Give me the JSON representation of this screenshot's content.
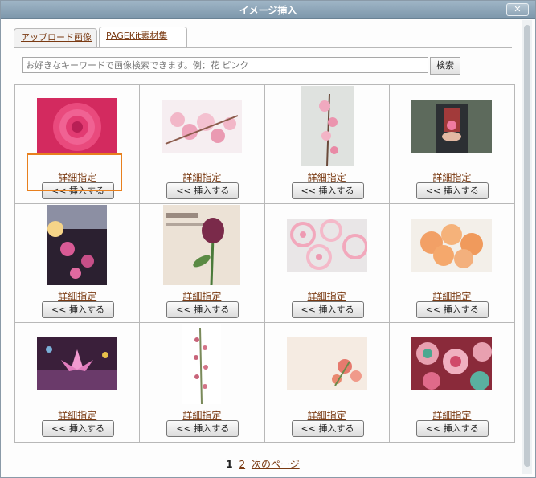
{
  "window": {
    "title": "イメージ挿入",
    "close_label": "✕"
  },
  "tabs": [
    {
      "label": "アップロード画像",
      "active": false
    },
    {
      "label": "PAGEKit素材集",
      "active": true
    }
  ],
  "search": {
    "placeholder": "お好きなキーワードで画像検索できます。例：花 ピンク",
    "button_label": "検索"
  },
  "grid": {
    "detail_label": "詳細指定",
    "insert_label": "<< 挿入する",
    "items": [
      {
        "image": "pink-rose"
      },
      {
        "image": "cherry-blossoms"
      },
      {
        "image": "cherry-blossom-branch"
      },
      {
        "image": "person-holding-flower"
      },
      {
        "image": "cosmos-sunset"
      },
      {
        "image": "tulip-vintage-poster"
      },
      {
        "image": "pink-circle-pattern"
      },
      {
        "image": "orange-roses"
      },
      {
        "image": "lotus-butterflies"
      },
      {
        "image": "heather-sprig"
      },
      {
        "image": "floral-card"
      },
      {
        "image": "pink-kaleidoscope-pattern"
      }
    ]
  },
  "pager": {
    "current": "1",
    "page2": "2",
    "next": "次のページ"
  }
}
